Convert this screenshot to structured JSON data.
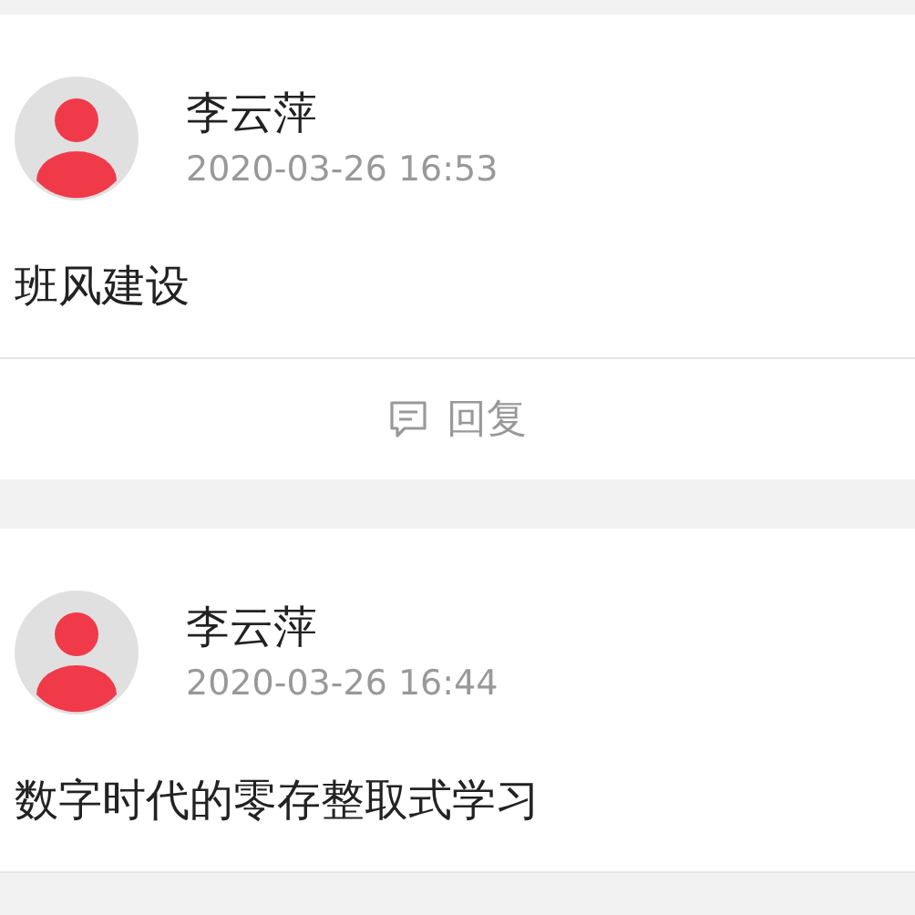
{
  "posts": [
    {
      "author": "李云萍",
      "time": "2020-03-26 16:53",
      "content": "班风建设",
      "reply": "回复"
    },
    {
      "author": "李云萍",
      "time": "2020-03-26 16:44",
      "content": "数字时代的零存整取式学习"
    }
  ]
}
